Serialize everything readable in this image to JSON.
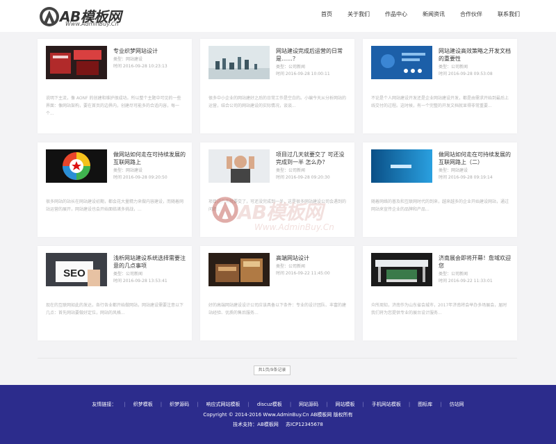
{
  "header": {
    "logo_text": "AB模板网",
    "logo_url": "Www.AdminBuy.Cn",
    "nav": [
      "首页",
      "关于我们",
      "作品中心",
      "新闻资讯",
      "合作伙伴",
      "联系我们"
    ]
  },
  "cards": [
    {
      "title": "专业织梦网站设计",
      "category": "类型：网站建设",
      "date": "时间 2016-09-28 10:23:13",
      "desc": "说明下主流，像 AONF 的创建和维护很成功。所以整个主题中可见的一些界面：像网站架构，要在首页的边界内，创建尽可能多的合适内容，每一个...",
      "thumb_icon": "trade-booth-photo"
    },
    {
      "title": "网站建设完成后运营的日常是……？",
      "category": "类型：公司新闻",
      "date": "时间 2016-09-28 10:00:11",
      "desc": "很多中小企业的网站建好之后的日常工作是空白的。小编今天从分析网站的运营，结合公司的网站建设的实际情况，谈谈...",
      "thumb_icon": "cityscape-photo"
    },
    {
      "title": "网站建设高效策略之开发文档的重要性",
      "category": "类型：公司新闻",
      "date": "时间 2016-09-28 09:53:08",
      "desc": "不论是个人网站建设开发还是企业网站建设开发，都是由需求开始到最后上线交付的过程。这时候，有一个完整的开发文档就显得非常重要...",
      "thumb_icon": "blue-tech-photo"
    },
    {
      "title": "做网站如何走在可持续发展的互联网路上",
      "category": "类型：网站建设",
      "date": "时间 2016-09-28 09:20:50",
      "desc": "很多网站的站长在网站建设初期，都会花大量精力来做内容建设，而随着网站运营的展开，网站建设也会开始面临诸多挑战，...",
      "thumb_icon": "color-circle-photo"
    },
    {
      "title": "项目过几天就要交了 可还没完成到一半 怎么办？",
      "category": "类型：公司新闻",
      "date": "时间 2016-09-28 09:20:30",
      "desc": "项目过几天就要交了，可还没完成到一半，这是很多网站建设公司会遇到的问题...",
      "thumb_icon": "stressed-man-photo"
    },
    {
      "title": "做网站如何走在可持续发展的互联网路上（二）",
      "category": "类型：网站建设",
      "date": "时间 2016-09-28 09:19:14",
      "desc": "随着网络的普及和互联网时代的到来，越来越多的企业开始建设网站，通过网站来宣传企业的品牌和产品...",
      "thumb_icon": "blue-screen-photo"
    },
    {
      "title": "浅析网站建设系统选择需要注意的几点事项",
      "category": "类型：公司新闻",
      "date": "时间 2016-09-28 13:53:41",
      "desc": "现在的互联网如此的发达，各行各业都开始做网站，网站建设需要注意以下几点：首先网站要做好定位，网站的风格...",
      "thumb_icon": "seo-card-photo"
    },
    {
      "title": "高端网站设计",
      "category": "类型：公司新闻",
      "date": "时间 2016-09-22 11:45:00",
      "desc": "好的高端网站建设设计公司应该具备以下条件：专业的设计团队、丰富的建站经验、优质的售后服务...",
      "thumb_icon": "exhibition-photo"
    },
    {
      "title": "济南展会即将开幕！詹域欢迎您",
      "category": "类型：公司新闻",
      "date": "时间 2016-09-22 11:33:01",
      "desc": "众所周知，济南作为山东省会城市，2017年济南将会举办多场展会，届时我们将为您提供专业的展台设计服务...",
      "thumb_icon": "exhibition-stand-photo"
    }
  ],
  "watermark": {
    "text": "AB模板网",
    "url": "Www.AdminBuy.Cn"
  },
  "pager": {
    "label": "共1页/9条记录"
  },
  "footer": {
    "links_label": "友情链接：",
    "links": [
      "织梦模板",
      "织梦源码",
      "响应式网站模板",
      "discuz模板",
      "网站源码",
      "网站模板",
      "手机网站模板",
      "图标库",
      "仿站网"
    ],
    "copyright": "Copyright © 2014-2016 Www.AdminBuy.Cn AB模板网 版权所有",
    "support_label": "技术支持：AB模板网",
    "icp": "苏ICP12345678"
  },
  "colors": {
    "footer_bg": "#2c2c8c",
    "page_bg": "#f3f3f5"
  }
}
